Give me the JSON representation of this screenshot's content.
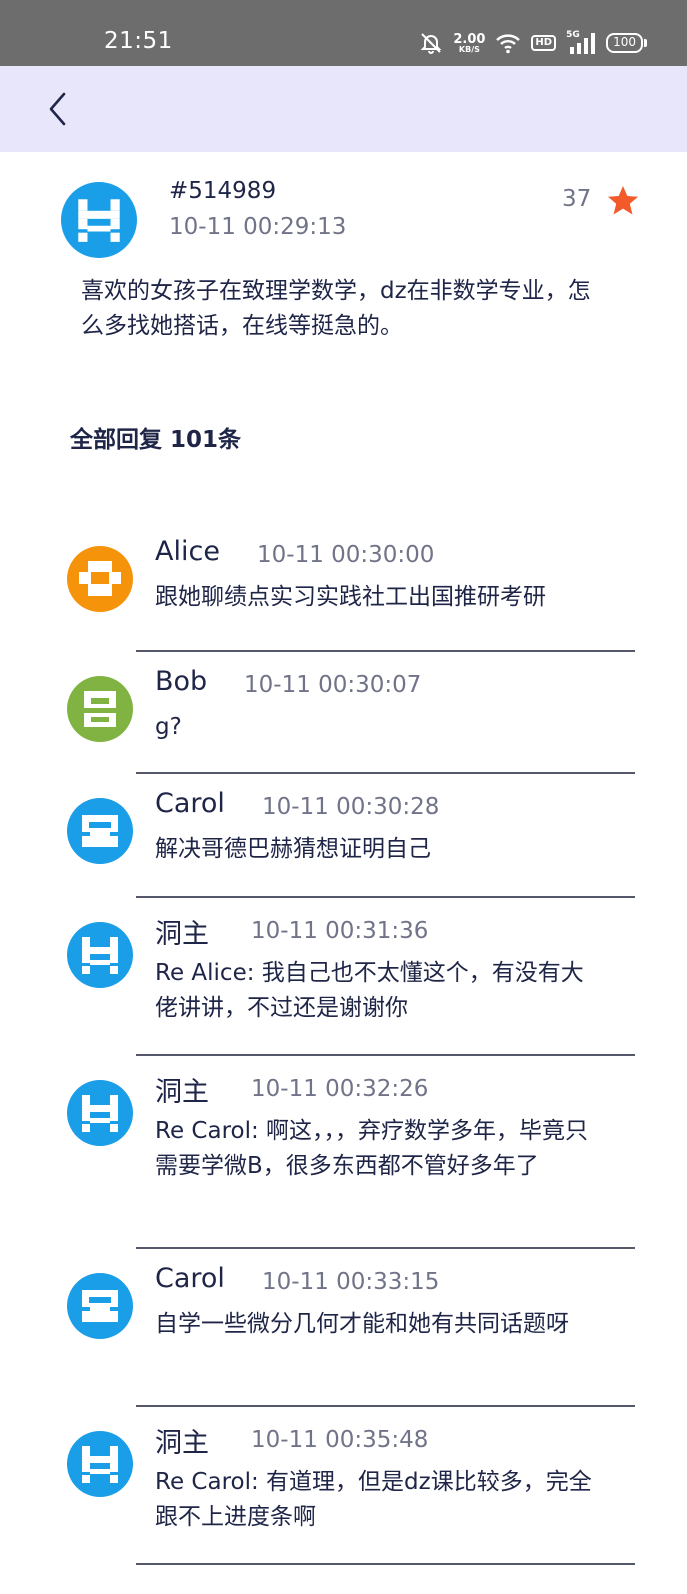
{
  "status_bar": {
    "time": "21:51",
    "net_speed_value": "2.00",
    "net_speed_unit": "KB/S",
    "hd": "HD",
    "signal_label": "5G",
    "battery": "100",
    "icons": [
      "bell-muted-icon",
      "wifi-icon",
      "hd-icon",
      "signal-icon",
      "battery-icon"
    ]
  },
  "app_bar": {
    "back_icon": "chevron-left-icon"
  },
  "post": {
    "id": "#514989",
    "time": "10-11 00:29:13",
    "star_count": "37",
    "star_icon": "star-icon",
    "star_color": "#f25a2a",
    "content": "喜欢的女孩子在致理学数学，dz在非数学专业，怎么多找她搭话，在线等挺急的。",
    "avatar_color": "#1a9ee8"
  },
  "reply_header": "全部回复 101条",
  "replies": [
    {
      "name": "Alice",
      "time": "10-11 00:30:00",
      "text": "跟她聊绩点实习实践社工出国推研考研",
      "avatar_color": "#f5930b",
      "avatar_type": "grid"
    },
    {
      "name": "Bob",
      "time": "10-11 00:30:07",
      "text": "g?",
      "avatar_color": "#80b341",
      "avatar_type": "bars"
    },
    {
      "name": "Carol",
      "time": "10-11 00:30:28",
      "text": "解决哥德巴赫猜想证明自己",
      "avatar_color": "#1a9ee8",
      "avatar_type": "box"
    },
    {
      "name": "洞主",
      "time": "10-11 00:31:36",
      "text": "Re Alice: 我自己也不太懂这个，有没有大佬讲讲，不过还是谢谢你",
      "avatar_color": "#1a9ee8",
      "avatar_type": "host"
    },
    {
      "name": "洞主",
      "time": "10-11 00:32:26",
      "text": "Re Carol: 啊这，，，弃疗数学多年，毕竟只需要学微B，很多东西都不管好多年了",
      "avatar_color": "#1a9ee8",
      "avatar_type": "host"
    },
    {
      "name": "Carol",
      "time": "10-11 00:33:15",
      "text": "自学一些微分几何才能和她有共同话题呀",
      "avatar_color": "#1a9ee8",
      "avatar_type": "box"
    },
    {
      "name": "洞主",
      "time": "10-11 00:35:48",
      "text": "Re Carol: 有道理，但是dz课比较多，完全跟不上进度条啊",
      "avatar_color": "#1a9ee8",
      "avatar_type": "host"
    }
  ]
}
